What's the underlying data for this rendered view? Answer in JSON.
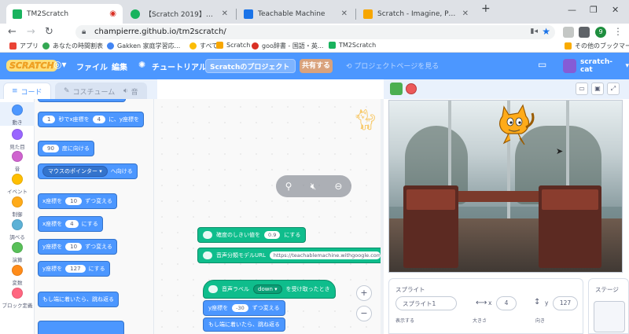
{
  "browser": {
    "tabs": [
      {
        "title": "TM2Scratch",
        "active": true
      },
      {
        "title": "【Scratch 2019】Scratch を使い音声..."
      },
      {
        "title": "Teachable Machine"
      },
      {
        "title": "Scratch - Imagine, Program, Share"
      }
    ],
    "url": "champierre.github.io/tm2scratch/",
    "profile_initial": "9",
    "bookmarks": [
      "アプリ",
      "あなたの時間割表",
      "Gakken 家庭学習応...",
      "すべて",
      "Scratch",
      "goo辞書 - 国語・英...",
      "TM2Scratch"
    ],
    "other_bookmarks": "その他のブックマーク"
  },
  "menubar": {
    "logo": "SCRATCH",
    "file": "ファイル",
    "edit": "編集",
    "tutorials": "チュートリアル",
    "project_title": "Scratchのプロジェクト",
    "share": "共有する",
    "see_project_page": "プロジェクトページを見る",
    "username": "scratch-cat"
  },
  "editor_tabs": {
    "code": "コード",
    "costumes": "コスチューム",
    "sounds": "音"
  },
  "categories": [
    {
      "label": "動き",
      "color": "#4c97ff"
    },
    {
      "label": "見た目",
      "color": "#9966ff"
    },
    {
      "label": "音",
      "color": "#cf63cf"
    },
    {
      "label": "イベント",
      "color": "#ffbf00"
    },
    {
      "label": "制御",
      "color": "#ffab19"
    },
    {
      "label": "調べる",
      "color": "#5cb1d6"
    },
    {
      "label": "演算",
      "color": "#59c059"
    },
    {
      "label": "変数",
      "color": "#ff8c1a"
    },
    {
      "label": "ブロック定義",
      "color": "#ff6680"
    }
  ],
  "palette": {
    "glide": {
      "n": "1",
      "text1": "秒でx座標を",
      "x": "4",
      "text2": "に、y座標を"
    },
    "point_dir": {
      "deg": "90",
      "text": "度に向ける"
    },
    "point_towards": {
      "target": "マウスのポインター",
      "text": "へ向ける"
    },
    "change_x": {
      "text1": "x座標を",
      "val": "10",
      "text2": "ずつ変える"
    },
    "set_x": {
      "text1": "x座標を",
      "val": "4",
      "text2": "にする"
    },
    "change_y": {
      "text1": "y座標を",
      "val": "10",
      "text2": "ずつ変える"
    },
    "set_y": {
      "text1": "y座標を",
      "val": "127",
      "text2": "にする"
    },
    "bounce": "もし端に着いたら、跳ね返る"
  },
  "code": {
    "threshold": {
      "text1": "確度のしきい値を",
      "val": "0.9",
      "text2": "にする"
    },
    "model_url": {
      "text": "音声分類モデルURL",
      "val": "https://teachablemachine.withgoogle.com/models/"
    },
    "hat": {
      "text1": "音声ラベル",
      "label": "down",
      "text2": "を受け取ったとき"
    },
    "change_y": {
      "text1": "y座標を",
      "val": "-30",
      "text2": "ずつ変える"
    },
    "bounce": "もし端に着いたら、跳ね返る"
  },
  "sprite_info": {
    "title": "スプライト",
    "name": "スプライト1",
    "x_label": "x",
    "x": "4",
    "y_label": "y",
    "y": "127",
    "show_label": "表示する",
    "size_label": "大きさ",
    "direction_label": "向き"
  },
  "stage_panel": {
    "label": "ステージ"
  },
  "colors": {
    "scratch_blue": "#4c97ff",
    "extension_green": "#0fbd8c",
    "control_orange": "#ffab19"
  }
}
